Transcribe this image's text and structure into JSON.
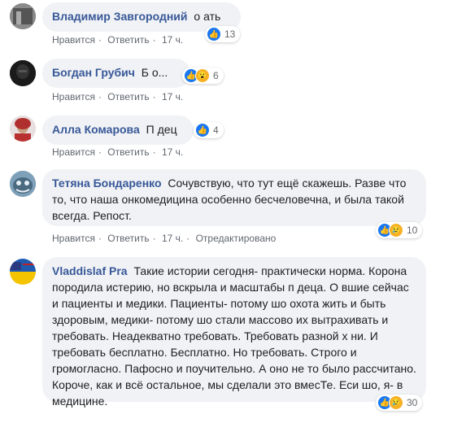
{
  "action_labels": {
    "like": "Нравится",
    "reply": "Ответить",
    "edited": "Отредактировано"
  },
  "comments": [
    {
      "author": "Владимир Завгородний",
      "text": "о  ать",
      "time": "17 ч.",
      "reactions": [
        "like"
      ],
      "count": "13",
      "edited": false
    },
    {
      "author": "Богдан Грубич",
      "text": "Б   о...",
      "time": "17 ч.",
      "reactions": [
        "like",
        "wow"
      ],
      "count": "6",
      "edited": false
    },
    {
      "author": "Алла Комарова",
      "text": "П   дец",
      "time": "17 ч.",
      "reactions": [
        "like"
      ],
      "count": "4",
      "edited": false
    },
    {
      "author": "Тетяна Бондаренко",
      "text": "Сочувствую, что тут ещё скажешь. Разве что то, что наша онкомедицина особенно бесчеловечна, и была такой всегда. Репост.",
      "time": "17 ч.",
      "reactions": [
        "like",
        "sad"
      ],
      "count": "10",
      "edited": true
    },
    {
      "author": "Vladdislaf Pra",
      "text": "Такие истории сегодня- практически норма. Корона породила истерию, но вскрыла и масштабы п   деца. О   вшие сейчас и пациенты и медики. Пациенты- потому шо охота жить и быть здоровым, медики- потому шо стали массово их вытрахивать и требовать. Неадекватно требовать. Требовать разной х   ни. И требовать бесплатно. Бесплатно. Но требовать. Строго и громогласно. Пафосно и поучительно. А оно не то было рассчитано. Короче, как и всё остальное, мы сделали это вмесТе. Еси шо, я- в медицине.",
      "time": "17 ч.",
      "reactions": [
        "like",
        "sad"
      ],
      "count": "30",
      "edited": false
    }
  ]
}
